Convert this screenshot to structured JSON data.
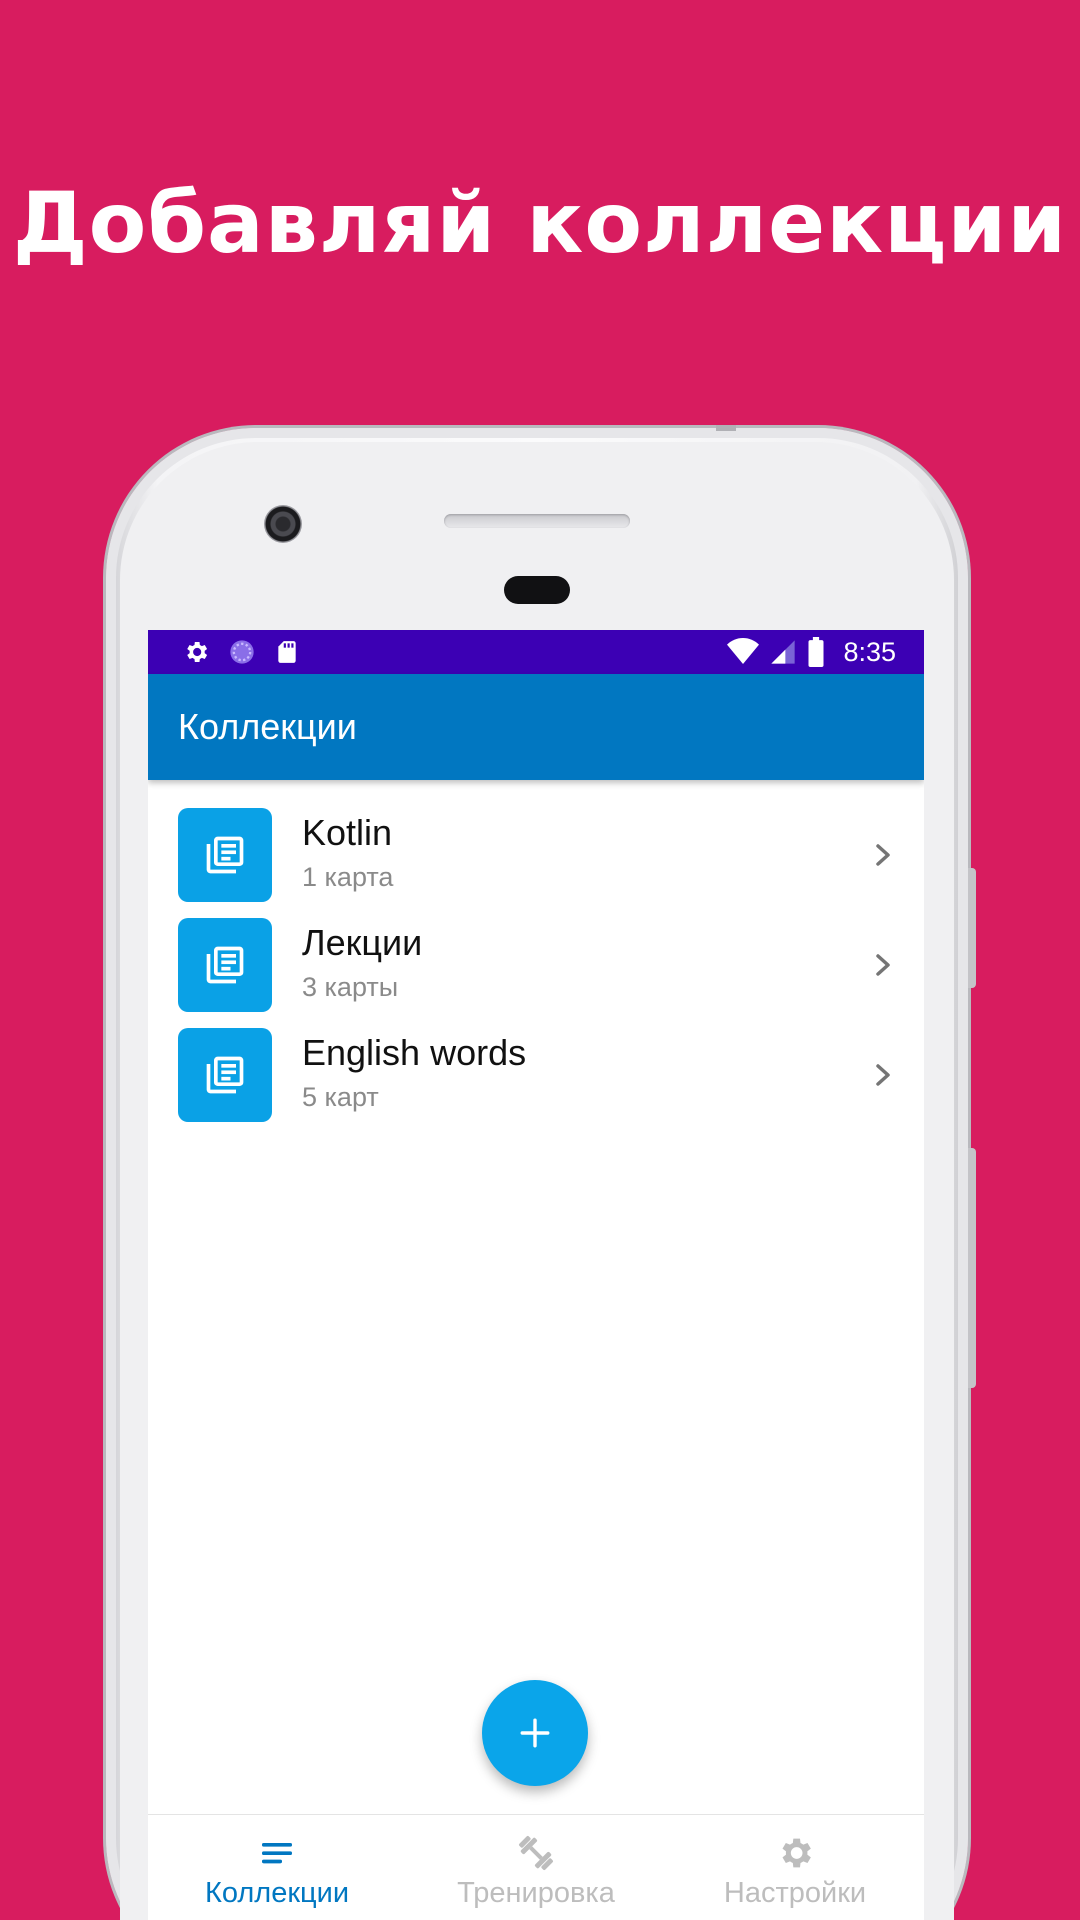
{
  "headline": "Добавляй коллекции",
  "status_bar": {
    "time": "8:35",
    "left_icons": [
      "settings-icon",
      "sync-icon",
      "sd-card-icon"
    ],
    "right_icons": [
      "wifi-icon",
      "signal-icon",
      "battery-icon"
    ]
  },
  "app_bar": {
    "title": "Коллекции"
  },
  "collections": [
    {
      "title": "Kotlin",
      "subtitle": "1 карта",
      "icon": "collection-icon"
    },
    {
      "title": "Лекции",
      "subtitle": "3 карты",
      "icon": "collection-icon"
    },
    {
      "title": "English words",
      "subtitle": "5 карт",
      "icon": "collection-icon"
    }
  ],
  "fab": {
    "icon": "plus-icon"
  },
  "bottom_nav": {
    "items": [
      {
        "label": "Коллекции",
        "icon": "list-icon",
        "active": true
      },
      {
        "label": "Тренировка",
        "icon": "dumbbell-icon",
        "active": false
      },
      {
        "label": "Настройки",
        "icon": "gear-icon",
        "active": false
      }
    ]
  },
  "colors": {
    "background": "#d81c5f",
    "status_bar": "#3c00b4",
    "app_bar": "#0177c1",
    "accent": "#0aa1e6",
    "nav_inactive": "#bdbdbd"
  }
}
